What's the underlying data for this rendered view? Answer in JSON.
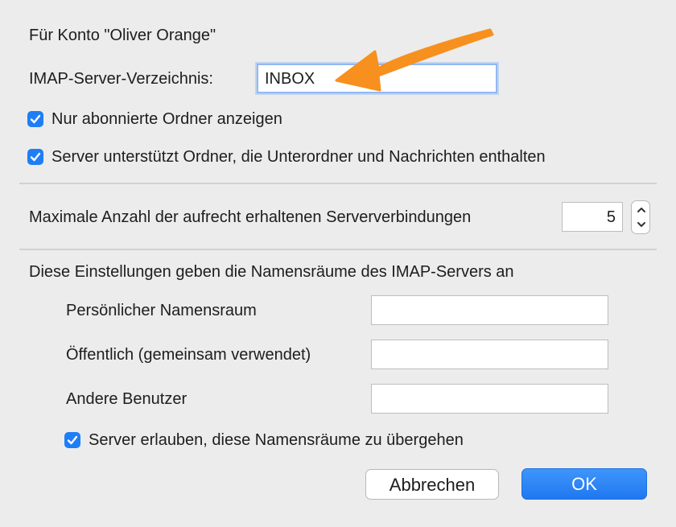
{
  "account_label": "Für Konto \"Oliver Orange\"",
  "imap": {
    "label": "IMAP-Server-Verzeichnis:",
    "value": "INBOX"
  },
  "checkboxes": {
    "subscribed_only": "Nur abonnierte Ordner anzeigen",
    "server_supports": "Server unterstützt Ordner, die Unterordner und Nachrichten enthalten"
  },
  "connections": {
    "label": "Maximale Anzahl der aufrecht erhaltenen Serververbindungen",
    "value": "5"
  },
  "namespaces": {
    "heading": "Diese Einstellungen geben die Namensräume des IMAP-Servers an",
    "personal_label": "Persönlicher Namensraum",
    "personal_value": "",
    "public_label": "Öffentlich (gemeinsam verwendet)",
    "public_value": "",
    "others_label": "Andere Benutzer",
    "others_value": "",
    "override_label": "Server erlauben, diese Namensräume zu übergehen"
  },
  "buttons": {
    "cancel": "Abbrechen",
    "ok": "OK"
  },
  "colors": {
    "accent": "#1f7ef5",
    "arrow": "#f7901e",
    "background": "#ececec"
  }
}
